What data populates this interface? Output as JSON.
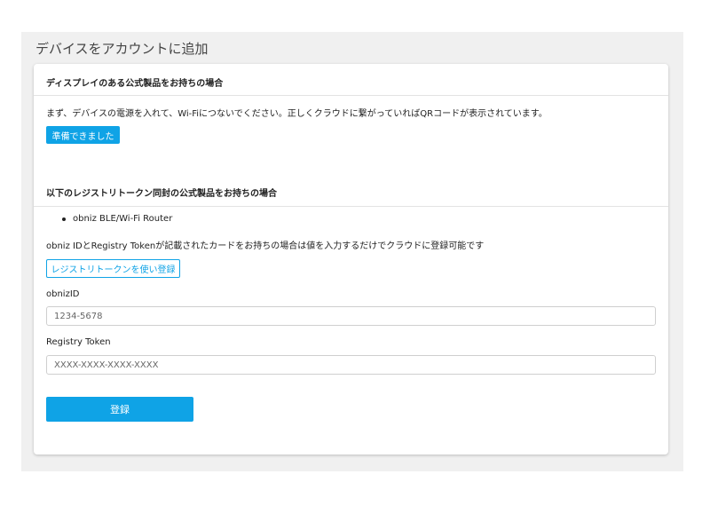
{
  "page": {
    "title": "デバイスをアカウントに追加"
  },
  "display_section": {
    "heading": "ディスプレイのある公式製品をお持ちの場合",
    "instruction": "まず、デバイスの電源を入れて、Wi-Fiにつないでください。正しくクラウドに繋がっていればQRコードが表示されています。",
    "ready_button": "準備できました"
  },
  "token_section": {
    "heading": "以下のレジストリトークン同封の公式製品をお持ちの場合",
    "products": [
      "obniz BLE/Wi-Fi Router"
    ],
    "description": "obniz IDとRegistry Tokenが記載されたカードをお持ちの場合は値を入力するだけでクラウドに登録可能です",
    "use_token_button": "レジストリトークンを使い登録",
    "obniz_id": {
      "label": "obnizID",
      "placeholder": "1234-5678",
      "value": ""
    },
    "registry_token": {
      "label": "Registry Token",
      "placeholder": "XXXX-XXXX-XXXX-XXXX",
      "value": ""
    },
    "register_button": "登録"
  },
  "colors": {
    "accent": "#0fa3e6",
    "page_background": "#f0f0f0",
    "card_background": "#ffffff"
  }
}
